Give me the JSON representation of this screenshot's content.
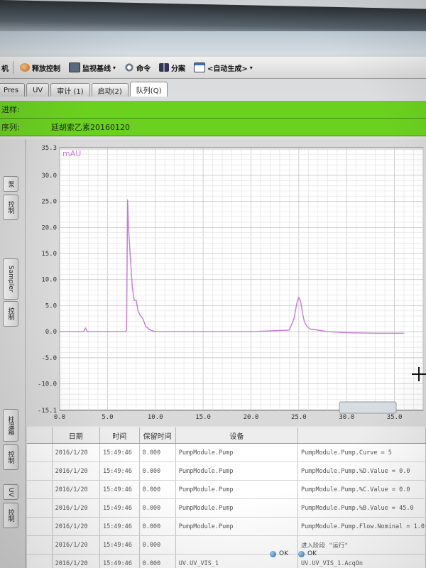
{
  "toolbar": {
    "partial_left": "机",
    "items": [
      {
        "label": "释放控制",
        "icon": "release-control-icon"
      },
      {
        "label": "监视基线",
        "icon": "monitor-baseline-icon"
      },
      {
        "label": "命令",
        "icon": "command-gear-icon"
      },
      {
        "label": "分案",
        "icon": "split-icon"
      },
      {
        "label": "<自动生成>",
        "icon": "window-icon"
      }
    ]
  },
  "tabs": [
    "Pres",
    "UV",
    "审计 (1)",
    "启动(2)",
    "队列(Q)"
  ],
  "status": {
    "run_label": "进样:",
    "run_value": "",
    "sequence_label": "序列:",
    "sequence_value": "延胡索乙素20160120"
  },
  "side_tabs": [
    "泵",
    "控制",
    "Sampler",
    "控制",
    "柱温箱",
    "控制",
    "UV",
    "控制"
  ],
  "chart_data": {
    "type": "line",
    "unit_label": "mAU",
    "xlim": [
      0.0,
      38.0
    ],
    "ylim": [
      -15.1,
      35.3
    ],
    "x_ticks": [
      "0.0",
      "5.0",
      "10.0",
      "15.0",
      "20.0",
      "25.0",
      "30.0",
      "35.0"
    ],
    "y_ticks": [
      "35.3",
      "30.0",
      "25.0",
      "20.0",
      "15.0",
      "10.0",
      "5.0",
      "0.0",
      "-5.0",
      "-10.0",
      "-15.1"
    ],
    "grid": true,
    "color": "#c77ad8",
    "series": [
      {
        "x": [
          0.0,
          2.5,
          2.7,
          2.9,
          3.2,
          6.9,
          7.0,
          7.1,
          7.2,
          7.4,
          7.6,
          7.8,
          8.0,
          8.2,
          8.4,
          8.7,
          9.0,
          9.5,
          10.0,
          15.0,
          20.0,
          24.0,
          24.5,
          24.8,
          25.0,
          25.2,
          25.4,
          25.6,
          25.9,
          26.2,
          27.0,
          28.0,
          30.0,
          33.0,
          36.0
        ],
        "y": [
          0.0,
          0.0,
          0.7,
          0.0,
          0.0,
          0.0,
          0.3,
          25.3,
          20.0,
          14.0,
          8.5,
          6.0,
          6.0,
          4.0,
          3.2,
          2.5,
          1.0,
          0.3,
          0.0,
          0.0,
          0.0,
          0.3,
          2.5,
          5.5,
          6.6,
          5.8,
          3.5,
          1.8,
          0.9,
          0.5,
          0.3,
          0.0,
          -0.2,
          -0.3,
          -0.3
        ]
      }
    ]
  },
  "table": {
    "headers": [
      "日期",
      "时间",
      "保留时间",
      "设备",
      ""
    ],
    "rows": [
      [
        "2016/1/20",
        "15:49:46",
        "0.000",
        "PumpModule.Pump",
        "PumpModule.Pump.Curve = 5"
      ],
      [
        "2016/1/20",
        "15:49:46",
        "0.000",
        "PumpModule.Pump",
        "PumpModule.Pump.%D.Value = 0.0"
      ],
      [
        "2016/1/20",
        "15:49:46",
        "0.000",
        "PumpModule.Pump",
        "PumpModule.Pump.%C.Value = 0.0"
      ],
      [
        "2016/1/20",
        "15:49:46",
        "0.000",
        "PumpModule.Pump",
        "PumpModule.Pump.%B.Value = 45.0"
      ],
      [
        "2016/1/20",
        "15:49:46",
        "0.000",
        "PumpModule.Pump",
        "PumpModule.Pump.Flow.Nominal = 1.0"
      ],
      [
        "2016/1/20",
        "15:49:46",
        "0.000",
        "",
        "进入阶段 \"运行\""
      ],
      [
        "2016/1/20",
        "15:49:46",
        "0.000",
        "UV.UV_VIS_1",
        "UV.UV_VIS_1.AcqOn"
      ]
    ]
  },
  "statusbar": {
    "left": "OK",
    "right": "OK"
  }
}
